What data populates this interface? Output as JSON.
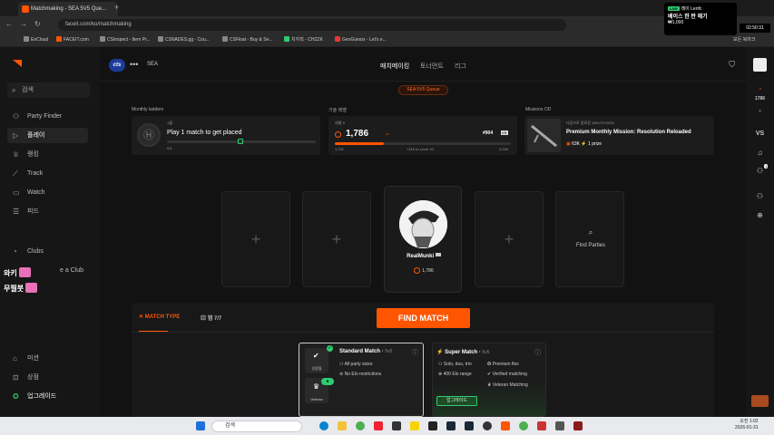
{
  "browser": {
    "tab_title": "Matchmaking - SEA 5V5 Que...",
    "url": "faceit.com/ko/matchmaking",
    "bookmarks": [
      "EnCloud",
      "FACEIT.com",
      "CSInspect - Item Pr...",
      "CSNADES.gg - Cou...",
      "CSFloat - Buy & Se...",
      "치지직 - CHZZK",
      "GeoGuessr - Let's e..."
    ],
    "all_bookmarks": "모든 북마크"
  },
  "popup": {
    "live": "LIVE",
    "user": "레이 Lenfc",
    "title": "베이스 한 판 해기",
    "amount": "₩1,000",
    "timer": "02:50:31"
  },
  "sidebar": {
    "search": "검색",
    "items": [
      "Party Finder",
      "플레이",
      "랭킹",
      "Track",
      "Watch",
      "피드",
      "Clubs",
      "미션",
      "상점",
      "업그레이드"
    ],
    "create_club_partial": "e a Club",
    "overlay1": "와키",
    "overlay2": "무찔붓"
  },
  "topnav": {
    "team": "cts",
    "region": "SEA",
    "tabs": [
      "매치메이킹",
      "토너먼트",
      "리그"
    ]
  },
  "queue_badge": "SEA 5V5 Queue",
  "panels": {
    "monthly": {
      "label": "Monthly ladders",
      "rank": "1월",
      "text": "Play 1 match to get placed",
      "progress": "0/1",
      "progress_fraction": 0.0
    },
    "skill": {
      "label": "기술 레벨",
      "level_label": "레벨 9",
      "elo": "1,786",
      "rank_pos": "#904",
      "flag": "KR",
      "min": "1,701",
      "to_next": "+215 to Level 10",
      "max": "2,000",
      "progress_fraction": 0.28
    },
    "missions": {
      "label": "Missions OD",
      "meta": "다음으로 종료됨 10D:07H:57M",
      "title": "Premium Monthly Mission: Resolution Reloaded",
      "points": "63K",
      "prize": "1 prize"
    }
  },
  "party": {
    "player_name": "RealMunki",
    "player_elo": "1,786",
    "find_parties": "Find Parties"
  },
  "bottom": {
    "tab_match_type": "MATCH TYPE",
    "tab_maps": "맵 7/7",
    "find_match": "FIND MATCH",
    "standard": {
      "title": "Standard Match",
      "mode": "5v5",
      "badge1": "인증됨",
      "badge2": "Veteran",
      "features": [
        "All party sizes",
        "No Elo restrictions"
      ]
    },
    "super": {
      "title": "Super Match",
      "mode": "5v5",
      "features_left": [
        "Solo, duo, trio",
        "400 Elo range"
      ],
      "features_right": [
        "Premium flex",
        "Verified matching",
        "Veteran Matching"
      ],
      "upgrade": "업그레이드"
    }
  },
  "rightbar": {
    "elo": "1786",
    "vs": "VS",
    "notif": "1"
  },
  "taskbar": {
    "search": "검색",
    "time": "오전 1:02",
    "date": "2026-01-31"
  },
  "colors": {
    "accent": "#ff5500",
    "green": "#2ecc71",
    "bg": "#121212"
  }
}
